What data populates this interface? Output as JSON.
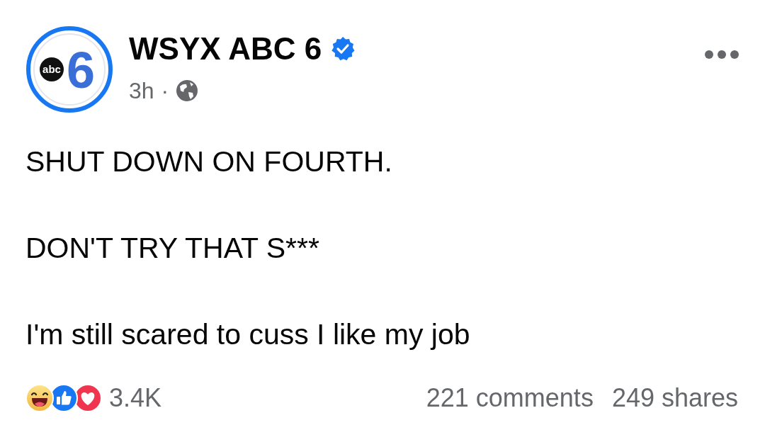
{
  "post": {
    "avatar": {
      "logo_text": "abc",
      "logo_number": "6"
    },
    "author": "WSYX ABC 6",
    "verified": true,
    "time": "3h",
    "separator": "·",
    "paragraphs": [
      "SHUT DOWN ON FOURTH.",
      "DON'T TRY THAT S***",
      "I'm still scared to cuss I like my job"
    ],
    "reactions": [
      {
        "kind": "haha"
      },
      {
        "kind": "like"
      },
      {
        "kind": "love"
      }
    ],
    "reaction_count": "3.4K",
    "comments": "221 comments",
    "shares": "249 shares"
  }
}
